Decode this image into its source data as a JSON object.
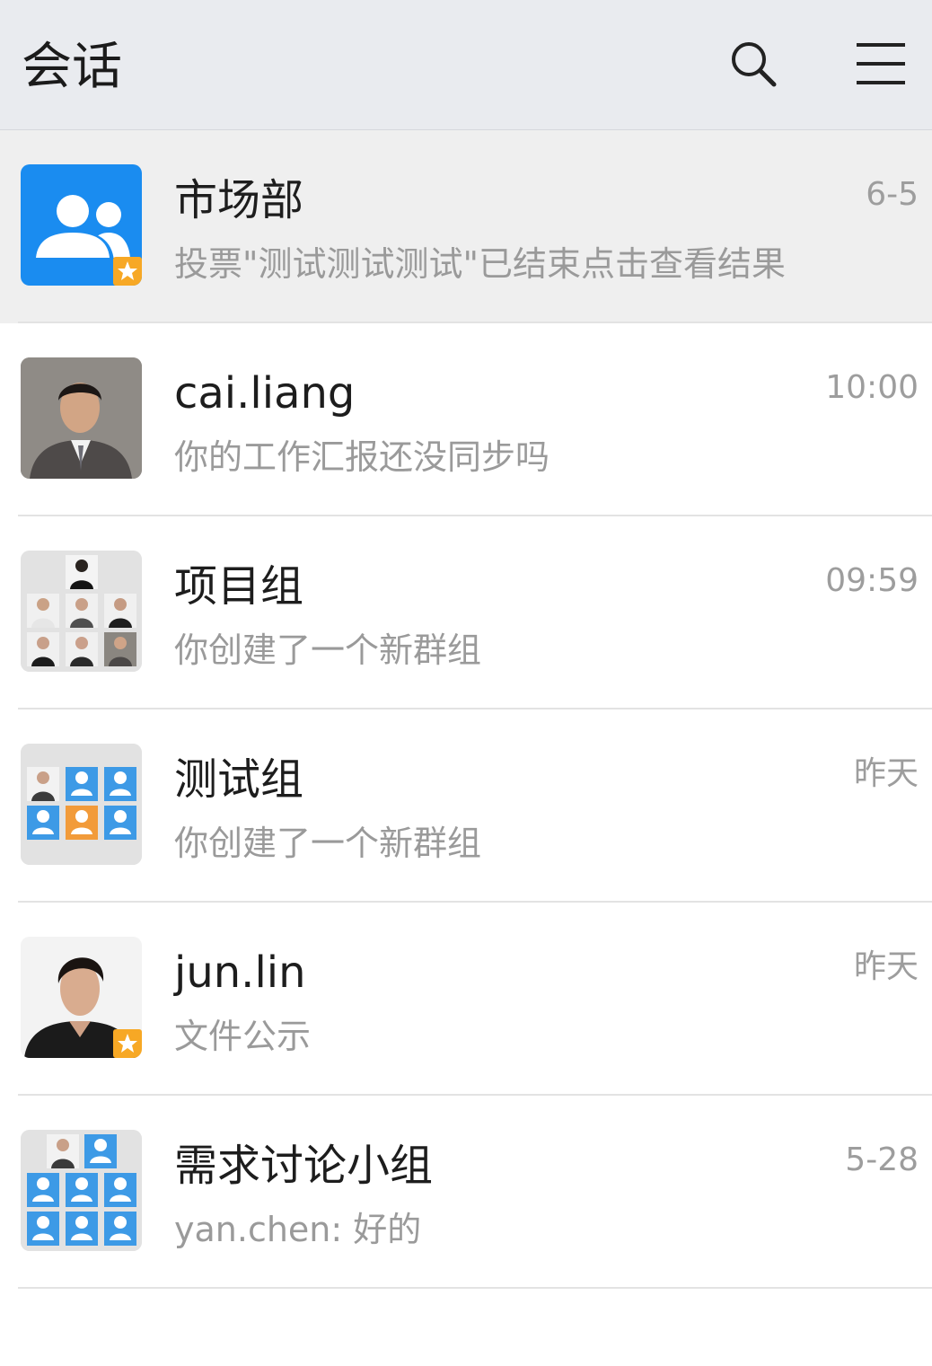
{
  "header": {
    "title": "会话"
  },
  "icons": {
    "search": "search-icon",
    "menu": "menu-icon",
    "group": "group-people-icon",
    "star_badge": "star-badge-icon"
  },
  "colors": {
    "header_bg": "#e9ebef",
    "highlight_row": "#efefef",
    "group_blue": "#1a8cf0",
    "badge_orange": "#f7a825",
    "member_blue": "#3d9ae6"
  },
  "conversations": [
    {
      "title": "市场部",
      "preview": "投票\"测试测试测试\"已结束点击查看结果",
      "time": "6-5"
    },
    {
      "title": "cai.liang",
      "preview": "你的工作汇报还没同步吗",
      "time": "10:00"
    },
    {
      "title": "项目组",
      "preview": "你创建了一个新群组",
      "time": "09:59"
    },
    {
      "title": "测试组",
      "preview": "你创建了一个新群组",
      "time": "昨天"
    },
    {
      "title": "jun.lin",
      "preview": "文件公示",
      "time": "昨天"
    },
    {
      "title": "需求讨论小组",
      "preview": "yan.chen: 好的",
      "time": "5-28"
    }
  ]
}
